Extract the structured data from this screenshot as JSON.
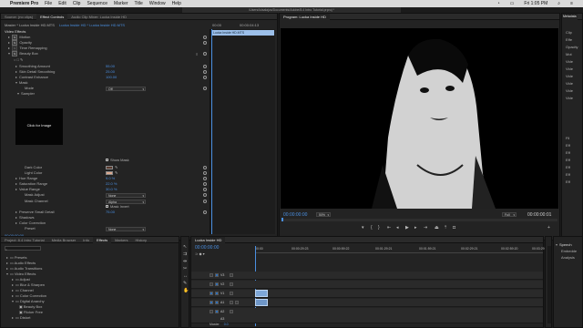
{
  "menubar": {
    "app": "Premiere Pro",
    "items": [
      "File",
      "Edit",
      "Clip",
      "Sequence",
      "Marker",
      "Title",
      "Window",
      "Help"
    ],
    "time": "Fri 1:05 PM"
  },
  "document_title": "/Users/luisalajos/Documents/Adobe/8.4 Intro Tutorial.prproj *",
  "effect_controls": {
    "tabs": [
      "Source: (no clips)",
      "Effect Controls",
      "Audio Clip Mixer: Lucka Inside HD"
    ],
    "master": "Master * Lucka Inside HD.MTS",
    "sequence": "Lucka Inside HD * Lucka Inside HD.MTS",
    "timecode_start": "00:00",
    "timecode_end": "00:00:04:13",
    "clip_name": "Lucka Inside HD.MTS",
    "section_video_effects": "Video Effects",
    "effects": [
      {
        "name": "Motion",
        "indent": 2
      },
      {
        "name": "Opacity",
        "indent": 2
      },
      {
        "name": "Time Remapping",
        "indent": 2
      },
      {
        "name": "Beauty Box",
        "indent": 2
      }
    ],
    "params": [
      {
        "name": "Smoothing Amount",
        "value": "55.00"
      },
      {
        "name": "Skin Detail Smoothing",
        "value": "25.00"
      },
      {
        "name": "Contrast Enhance",
        "value": "100.00"
      }
    ],
    "mask_label": "Mask",
    "mode_label": "Mode",
    "mode_value": "Off",
    "sampler_label": "Sampler",
    "click_for_image": "Click for Image",
    "show_mask": "Show Mask",
    "dark_color": "Dark Color",
    "light_color": "Light Color",
    "dark_color_hex": "#5a3a2e",
    "light_color_hex": "#d9a88f",
    "ranges": [
      {
        "name": "Hue Range",
        "value": "9.0 %"
      },
      {
        "name": "Saturation Range",
        "value": "22.0 %"
      },
      {
        "name": "Value Range",
        "value": "30.0 %"
      }
    ],
    "mask_adjust": "Mask Adjust",
    "mask_adjust_value": "None",
    "mask_channel": "Mask Channel",
    "mask_channel_value": "Alpha",
    "mask_invert": "Mask Invert",
    "preserve_detail": "Preserve Small Detail",
    "preserve_value": "75.00",
    "shadows": "Shadows",
    "color_correction": "Color Correction",
    "preset": "Preset",
    "preset_value": "None",
    "bottom_timecode": "00:00:00:00"
  },
  "program": {
    "tab": "Program: Lucka Inside HD",
    "timecode": "00:00:00:00",
    "zoom": "50%",
    "quality": "Full",
    "duration": "00:00:00:01"
  },
  "metadata_tab": "Metadata",
  "right_panel": {
    "items": [
      "Clip",
      "Effe",
      "Opacity",
      "Mot",
      "Vide",
      "Vide",
      "Vide",
      "Vide",
      "Vide",
      "Vide",
      "Fil",
      "Eff",
      "Eff",
      "Eff",
      "Eff",
      "Eff",
      "Eff"
    ]
  },
  "project": {
    "tabs": [
      "Project: 8.4 Intro Tutorial",
      "Media Browser",
      "Info",
      "Effects",
      "Markers",
      "History"
    ],
    "tree": [
      {
        "name": "Presets",
        "indent": 1
      },
      {
        "name": "Audio Effects",
        "indent": 1
      },
      {
        "name": "Audio Transitions",
        "indent": 1
      },
      {
        "name": "Video Effects",
        "indent": 1
      },
      {
        "name": "Adjust",
        "indent": 2
      },
      {
        "name": "Blur & Sharpen",
        "indent": 2
      },
      {
        "name": "Channel",
        "indent": 2
      },
      {
        "name": "Color Correction",
        "indent": 2
      },
      {
        "name": "Digital Anarchy",
        "indent": 2
      },
      {
        "name": "Beauty Box",
        "indent": 3
      },
      {
        "name": "Flicker Free",
        "indent": 3
      },
      {
        "name": "Distort",
        "indent": 2
      }
    ]
  },
  "timeline": {
    "tab": "Lucka Inside HD",
    "timecode": "00:00:00:00",
    "ruler": [
      "00:00",
      "00:00:29:23",
      "00:00:59:22",
      "00:01:29:21",
      "00:01:59:21",
      "00:02:29:21",
      "00:02:59:20",
      "00:03:29:"
    ],
    "tracks": [
      "V3",
      "V2",
      "V1",
      "A1",
      "A2",
      "A3"
    ],
    "master": "Master",
    "master_value": "0.0"
  },
  "speech_panel": {
    "title": "Speech",
    "items": [
      "Embedde",
      "Analysis"
    ]
  },
  "colors": {
    "accent": "#4a8fe0",
    "panel": "#232323",
    "clip": "#7ea7d8"
  }
}
